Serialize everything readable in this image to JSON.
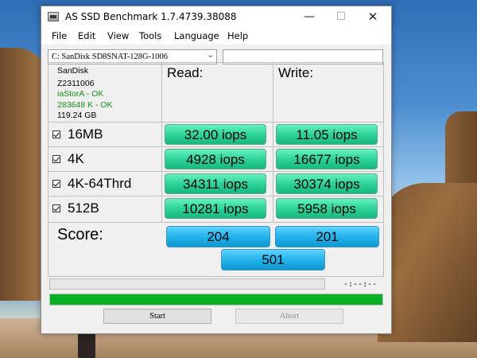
{
  "window": {
    "title": "AS SSD Benchmark 1.7.4739.38088",
    "minimize": "—",
    "maximize": "☐",
    "close": "✕"
  },
  "menu": [
    "File",
    "Edit",
    "View",
    "Tools",
    "Language",
    "Help"
  ],
  "drive": {
    "selected": "C: SanDisk SD8SNAT-128G-1006",
    "arrow": "⌄",
    "text_value": ""
  },
  "info": {
    "vendor": "SanDisk",
    "firmware": "Z2311006",
    "driver_status": "iaStorA - OK",
    "alignment_status": "283648 K - OK",
    "capacity": "119.24 GB",
    "ok_color": "#1a8f1a"
  },
  "columns": {
    "read": "Read:",
    "write": "Write:"
  },
  "tests": [
    {
      "label": "16MB",
      "checked": true,
      "read": "32.00 iops",
      "write": "11.05 iops"
    },
    {
      "label": "4K",
      "checked": true,
      "read": "4928 iops",
      "write": "16677 iops"
    },
    {
      "label": "4K-64Thrd",
      "checked": true,
      "read": "34311 iops",
      "write": "30374 iops"
    },
    {
      "label": "512B",
      "checked": true,
      "read": "10281 iops",
      "write": "5958 iops"
    }
  ],
  "score": {
    "label": "Score:",
    "read": "204",
    "write": "201",
    "total": "501"
  },
  "progress": {
    "time": "-:--:--",
    "main_fraction": 1.0,
    "small_fraction": 0.0,
    "fill_color": "#06b025"
  },
  "buttons": {
    "start": "Start",
    "abort": "Abort"
  },
  "colors": {
    "result_green": "#2ed39a",
    "score_blue": "#23b3ea"
  }
}
